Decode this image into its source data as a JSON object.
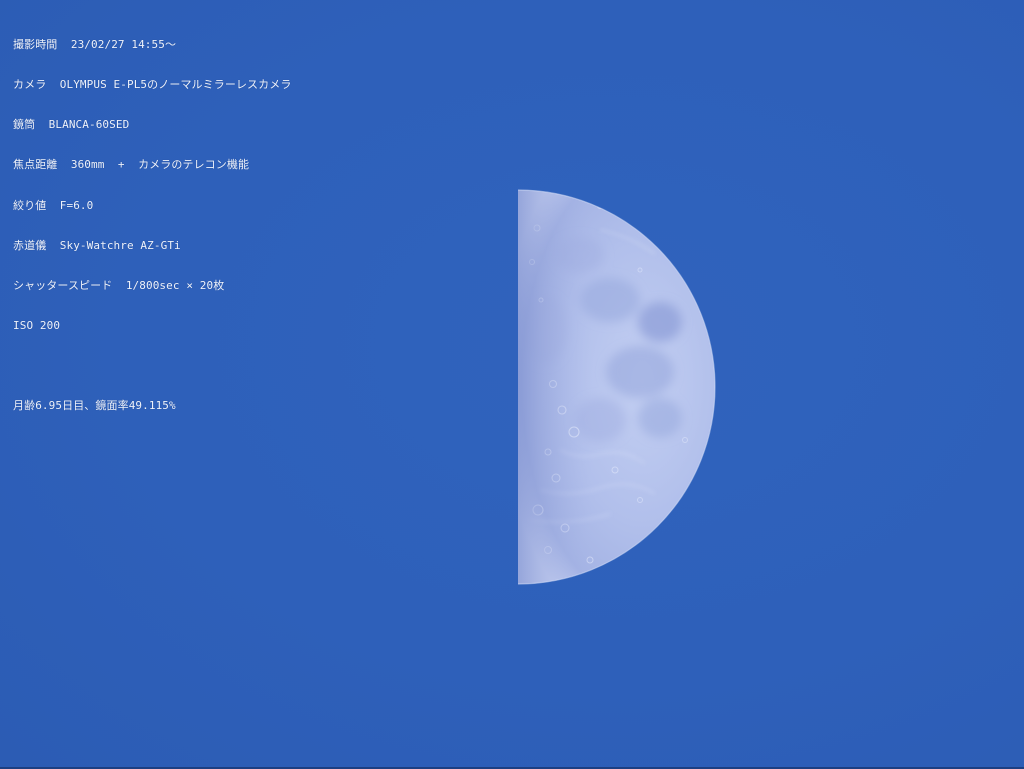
{
  "caption": {
    "shooting_time_label": "撮影時間",
    "shooting_time_value": "23/02/27 14:55〜",
    "camera_label": "カメラ",
    "camera_value": "OLYMPUS E-PL5のノーマルミラーレスカメラ",
    "telescope_label": "鏡筒",
    "telescope_value": "BLANCA-60SED",
    "focal_length_label": "焦点距離",
    "focal_length_value": "360mm  +  カメラのテレコン機能",
    "aperture_label": "絞り値",
    "aperture_value": "F=6.0",
    "mount_label": "赤道儀",
    "mount_value": "Sky-Watchre AZ-GTi",
    "shutter_label": "シャッタースピード",
    "shutter_value": "1/800sec × 20枚",
    "iso_value": "ISO 200",
    "moon_info": "月齢6.95日目、鏡面率49.115%"
  },
  "colors": {
    "sky": "#2f61bb",
    "moon_light": "#b9c6ee",
    "moon_dark": "#8797d2",
    "caption_text": "#eef2fb"
  },
  "subject": "half-moon"
}
